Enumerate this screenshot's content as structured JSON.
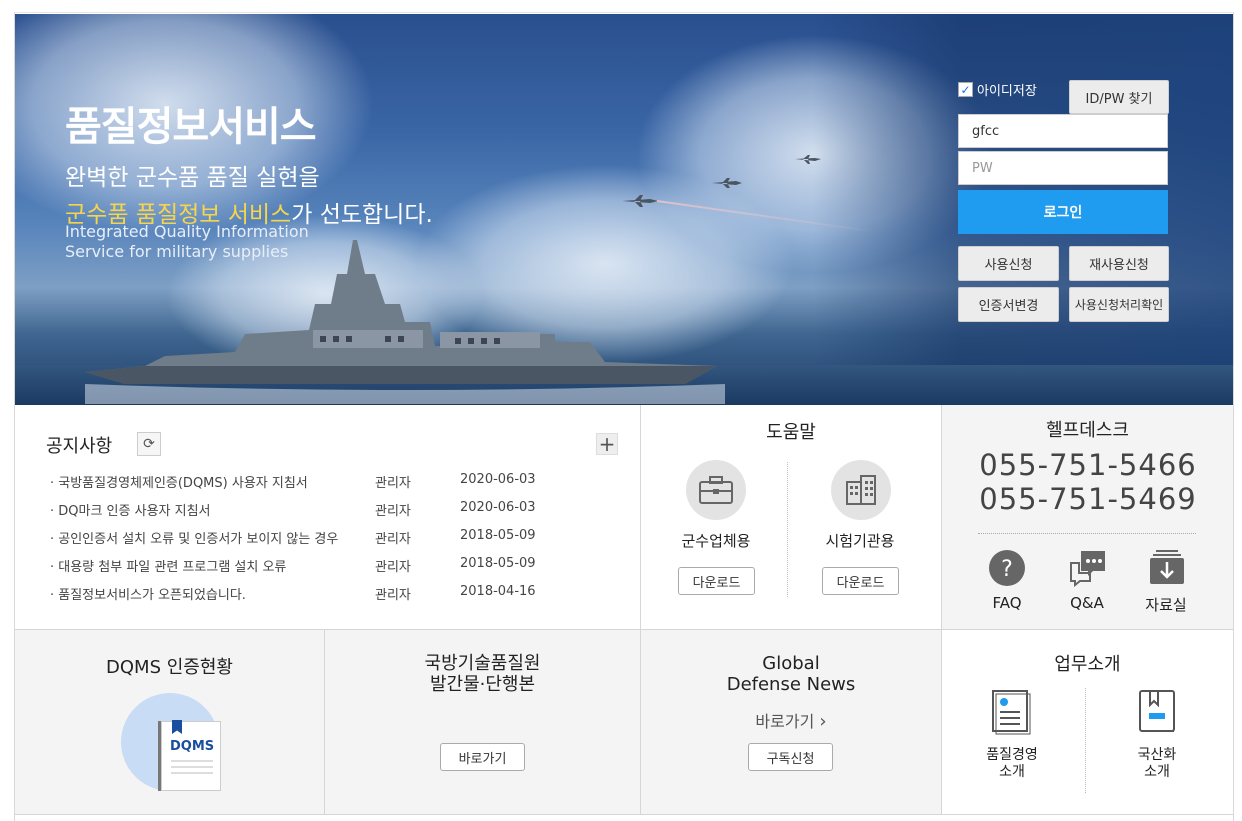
{
  "hero": {
    "title": "품질정보서비스",
    "subtitle1": "완벽한 군수품 품질 실현을",
    "subtitle2_highlight": "군수품 품질정보 서비스",
    "subtitle2_rest": "가 선도합니다.",
    "english_line1": "Integrated Quality Information",
    "english_line2": "Service for military supplies"
  },
  "login": {
    "save_id_label": "아이디저장",
    "save_id_checked": true,
    "find_idpw": "ID/PW 찾기",
    "id_value": "gfcc",
    "pw_placeholder": "PW",
    "login_button": "로그인",
    "btn_apply": "사용신청",
    "btn_reapply": "재사용신청",
    "btn_cert_change": "인증서변경",
    "btn_apply_check": "사용신청처리확인"
  },
  "notice": {
    "title": "공지사항",
    "items": [
      {
        "title": "국방품질경영체제인증(DQMS) 사용자 지침서",
        "author": "관리자",
        "date": "2020-06-03"
      },
      {
        "title": "DQ마크 인증 사용자 지침서",
        "author": "관리자",
        "date": "2020-06-03"
      },
      {
        "title": "공인인증서 설치 오류 및 인증서가 보이지 않는 경우",
        "author": "관리자",
        "date": "2018-05-09"
      },
      {
        "title": "대용량 첨부 파일 관련 프로그램 설치 오류",
        "author": "관리자",
        "date": "2018-05-09"
      },
      {
        "title": "품질정보서비스가 오픈되었습니다.",
        "author": "관리자",
        "date": "2018-04-16"
      }
    ]
  },
  "help": {
    "title": "도움말",
    "company_label": "군수업체용",
    "lab_label": "시험기관용",
    "download": "다운로드"
  },
  "helpdesk": {
    "title": "헬프데스크",
    "phone1": "055-751-5466",
    "phone2": "055-751-5469",
    "faq": "FAQ",
    "qna": "Q&A",
    "archive": "자료실"
  },
  "dqms": {
    "title": "DQMS 인증현황",
    "book_label": "DQMS"
  },
  "publication": {
    "title_line1": "국방기술품질원",
    "title_line2": "발간물·단행본",
    "go": "바로가기"
  },
  "news": {
    "title_line1": "Global",
    "title_line2": "Defense News",
    "go": "바로가기",
    "subscribe": "구독신청"
  },
  "work": {
    "title": "업무소개",
    "item1_line1": "품질경영",
    "item1_line2": "소개",
    "item2_line1": "국산화",
    "item2_line2": "소개"
  },
  "colors": {
    "login_blue": "#1f9bf0",
    "highlight_yellow": "#f7d54a"
  }
}
